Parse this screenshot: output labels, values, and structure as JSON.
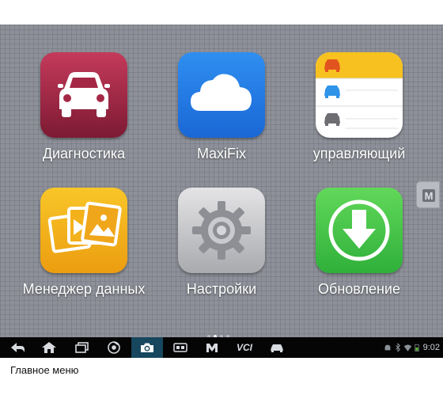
{
  "apps": [
    {
      "id": "diagnostics",
      "label": "Диагностика",
      "icon": "car-icon"
    },
    {
      "id": "maxifix",
      "label": "MaxiFix",
      "icon": "cloud-icon"
    },
    {
      "id": "management",
      "label": "управляющий",
      "icon": "vehicle-list-icon"
    },
    {
      "id": "data-manager",
      "label": "Менеджер данных",
      "icon": "photo-folder-icon"
    },
    {
      "id": "settings",
      "label": "Настройки",
      "icon": "gear-icon"
    },
    {
      "id": "update",
      "label": "Обновление",
      "icon": "download-arrow-icon"
    }
  ],
  "side_tab": {
    "icon": "m-logo-icon",
    "letter": "M"
  },
  "page_indicator": {
    "pages": 3,
    "current": 1
  },
  "navbar": {
    "buttons": [
      "back-icon",
      "home-icon",
      "recent-apps-icon",
      "chrome-icon",
      "camera-icon",
      "vehicle-interface-icon",
      "maxisys-icon",
      "vci-icon",
      "car-quick-icon"
    ],
    "vci_label": "VCI",
    "active": "camera-icon"
  },
  "status": {
    "time": "9:02",
    "icons": [
      "android-icon",
      "bluetooth-icon",
      "wifi-icon",
      "battery-icon"
    ]
  },
  "caption": "Главное меню",
  "colors": {
    "screen_bg": "#8d9098",
    "navbar_bg": "#050505",
    "active_nav": "#17465f"
  }
}
